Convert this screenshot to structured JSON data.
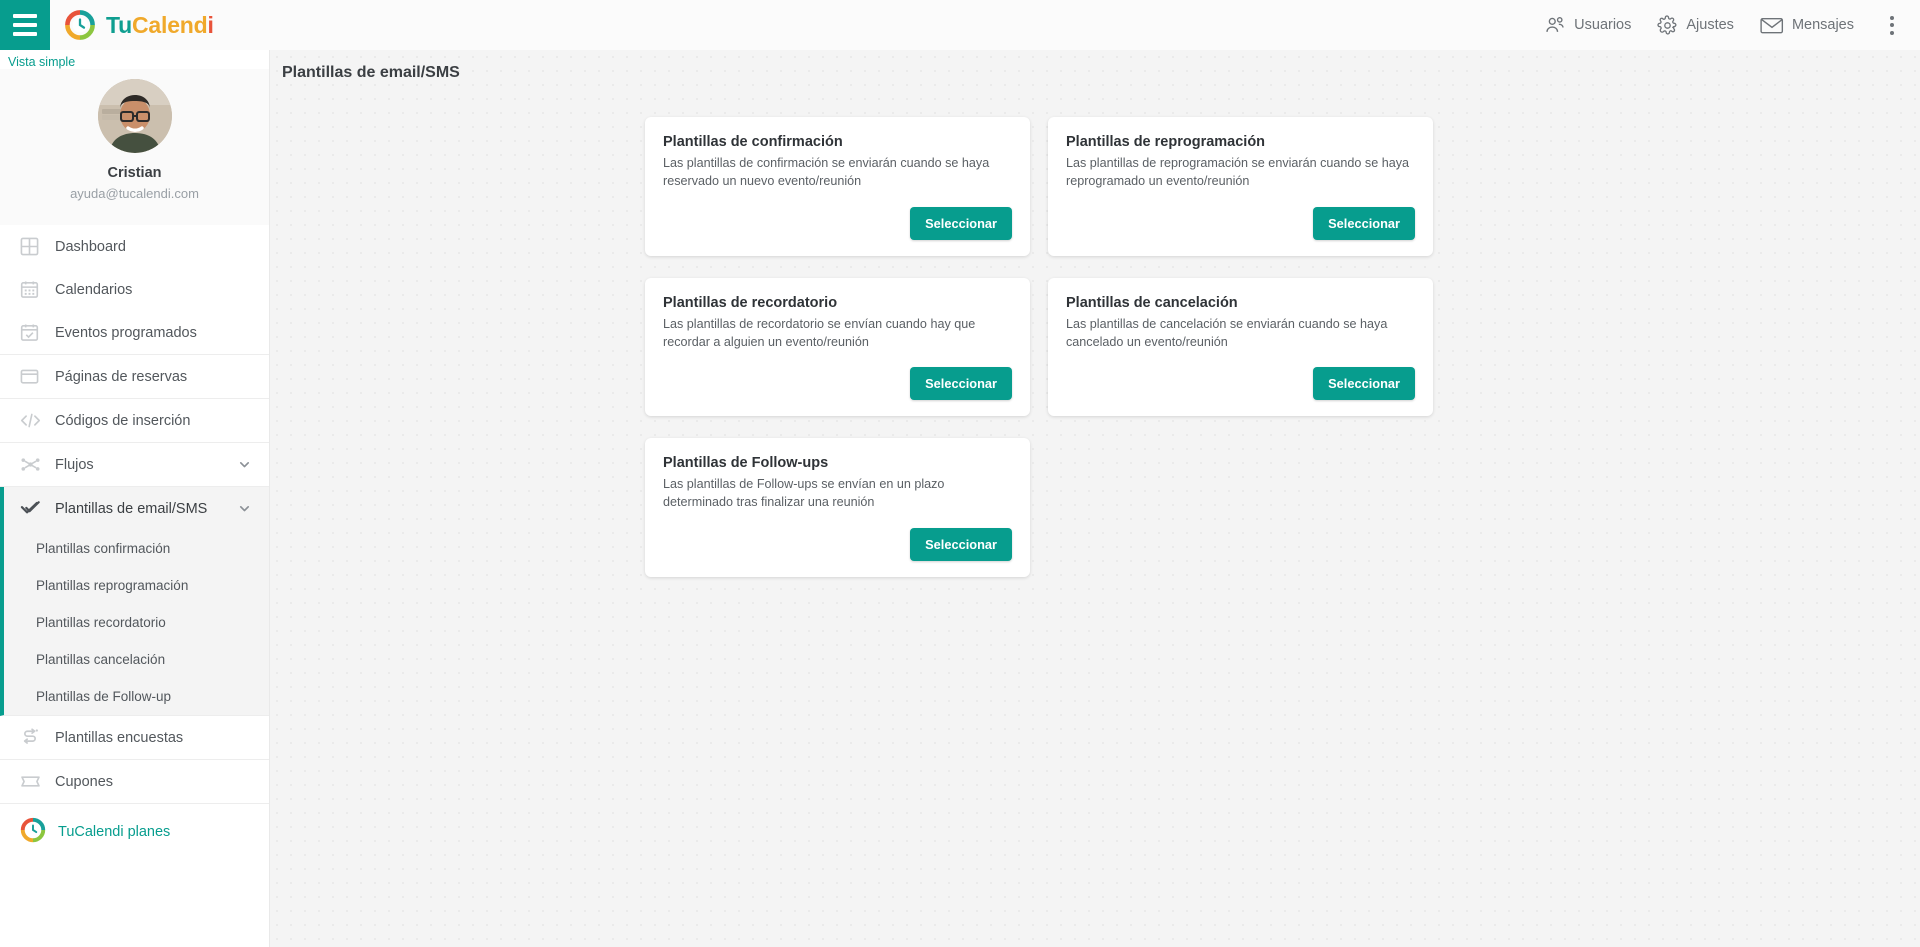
{
  "topbar": {
    "menu_icon": "hamburger-icon",
    "logo_icon": "tucalendi-logo-icon",
    "brand": {
      "part1": "Tu",
      "part2": "Calend",
      "part3": "i"
    },
    "items": [
      {
        "label": "Usuarios",
        "icon": "users-icon"
      },
      {
        "label": "Ajustes",
        "icon": "gear-icon"
      },
      {
        "label": "Mensajes",
        "icon": "envelope-icon"
      }
    ],
    "overflow_icon": "kebab-menu-icon"
  },
  "sidebar": {
    "view_toggle": "Vista simple",
    "profile": {
      "avatar_icon": "user-avatar-photo",
      "name": "Cristian",
      "email": "ayuda@tucalendi.com"
    },
    "items": [
      {
        "label": "Dashboard",
        "icon": "dashboard-grid-icon"
      },
      {
        "label": "Calendarios",
        "icon": "calendar-icon"
      },
      {
        "label": "Eventos programados",
        "icon": "calendar-check-icon"
      },
      {
        "label": "Páginas de reservas",
        "icon": "window-icon"
      },
      {
        "label": "Códigos de inserción",
        "icon": "code-brackets-icon"
      },
      {
        "label": "Flujos",
        "icon": "flow-nodes-icon",
        "chevron": "chevron-down-icon"
      },
      {
        "label": "Plantillas de email/SMS",
        "icon": "double-check-icon",
        "chevron": "chevron-down-icon",
        "active": true
      },
      {
        "label": "Plantillas encuestas",
        "icon": "survey-arrows-icon"
      },
      {
        "label": "Cupones",
        "icon": "ticket-icon"
      }
    ],
    "submenu": [
      "Plantillas confirmación",
      "Plantillas reprogramación",
      "Plantillas recordatorio",
      "Plantillas cancelación",
      "Plantillas de Follow-up"
    ],
    "plans": {
      "label": "TuCalendi planes",
      "icon": "tucalendi-logo-icon"
    }
  },
  "main": {
    "page_title": "Plantillas de email/SMS",
    "cards": [
      {
        "title": "Plantillas de confirmación",
        "description": "Las plantillas de confirmación se enviarán cuando se haya reservado un nuevo evento/reunión",
        "button": "Seleccionar"
      },
      {
        "title": "Plantillas de reprogramación",
        "description": "Las plantillas de reprogramación se enviarán cuando se haya reprogramado un evento/reunión",
        "button": "Seleccionar"
      },
      {
        "title": "Plantillas de recordatorio",
        "description": "Las plantillas de recordatorio se envían cuando hay que recordar a alguien un evento/reunión",
        "button": "Seleccionar"
      },
      {
        "title": "Plantillas de cancelación",
        "description": "Las plantillas de cancelación se enviarán cuando se haya cancelado un evento/reunión",
        "button": "Seleccionar"
      },
      {
        "title": "Plantillas de Follow-ups",
        "description": "Las plantillas de Follow-ups se envían en un plazo determinado tras finalizar una reunión",
        "button": "Seleccionar"
      }
    ]
  },
  "colors": {
    "accent_teal": "#079d8e",
    "brand_orange": "#f0a92b",
    "brand_red": "#e8533a",
    "brand_green": "#8cc63f",
    "page_bg": "#f4f4f4",
    "card_bg": "#ffffff"
  }
}
